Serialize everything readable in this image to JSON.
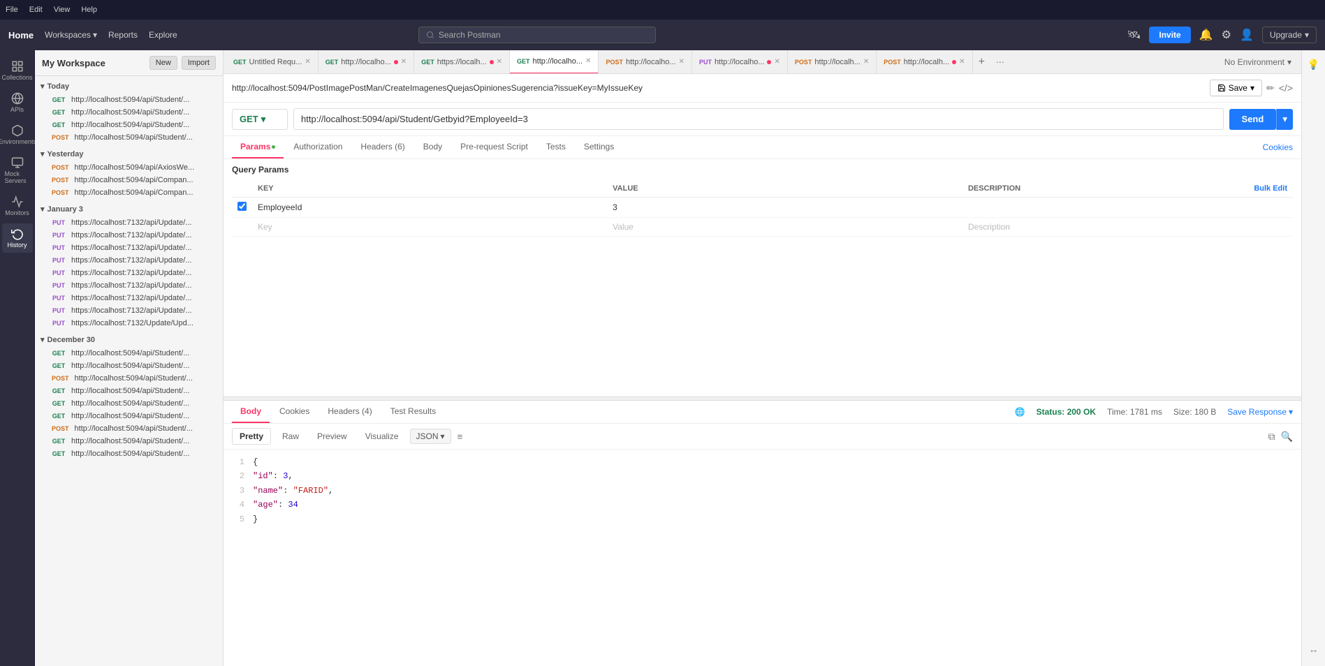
{
  "menubar": {
    "items": [
      "File",
      "Edit",
      "View",
      "Help"
    ]
  },
  "header": {
    "nav": [
      {
        "label": "Home"
      },
      {
        "label": "Workspaces",
        "hasArrow": true
      },
      {
        "label": "Reports"
      },
      {
        "label": "Explore"
      }
    ],
    "search": {
      "placeholder": "Search Postman"
    },
    "invite_label": "Invite",
    "upgrade_label": "Upgrade"
  },
  "sidebar": {
    "workspace_title": "My Workspace",
    "new_label": "New",
    "import_label": "Import",
    "icons": [
      {
        "name": "Collections",
        "icon": "collections-icon"
      },
      {
        "name": "APIs",
        "icon": "apis-icon"
      },
      {
        "name": "Environments",
        "icon": "environments-icon"
      },
      {
        "name": "Mock Servers",
        "icon": "mock-icon"
      },
      {
        "name": "Monitors",
        "icon": "monitors-icon"
      },
      {
        "name": "History",
        "icon": "history-icon"
      }
    ],
    "history_groups": [
      {
        "label": "Today",
        "items": [
          {
            "method": "GET",
            "url": "http://localhost:5094/api/Student/..."
          },
          {
            "method": "GET",
            "url": "http://localhost:5094/api/Student/..."
          },
          {
            "method": "GET",
            "url": "http://localhost:5094/api/Student/..."
          },
          {
            "method": "POST",
            "url": "http://localhost:5094/api/Student/..."
          }
        ]
      },
      {
        "label": "Yesterday",
        "items": [
          {
            "method": "POST",
            "url": "http://localhost:5094/api/AxiosWe..."
          },
          {
            "method": "POST",
            "url": "http://localhost:5094/api/Compan..."
          },
          {
            "method": "POST",
            "url": "http://localhost:5094/api/Compan..."
          }
        ]
      },
      {
        "label": "January 3",
        "items": [
          {
            "method": "PUT",
            "url": "https://localhost:7132/api/Update/..."
          },
          {
            "method": "PUT",
            "url": "https://localhost:7132/api/Update/..."
          },
          {
            "method": "PUT",
            "url": "https://localhost:7132/api/Update/..."
          },
          {
            "method": "PUT",
            "url": "https://localhost:7132/api/Update/..."
          },
          {
            "method": "PUT",
            "url": "https://localhost:7132/api/Update/..."
          },
          {
            "method": "PUT",
            "url": "https://localhost:7132/api/Update/..."
          },
          {
            "method": "PUT",
            "url": "https://localhost:7132/api/Update/..."
          },
          {
            "method": "PUT",
            "url": "https://localhost:7132/api/Update/..."
          },
          {
            "method": "PUT",
            "url": "https://localhost:7132/Update/Upd..."
          }
        ]
      },
      {
        "label": "December 30",
        "items": [
          {
            "method": "GET",
            "url": "http://localhost:5094/api/Student/..."
          },
          {
            "method": "GET",
            "url": "http://localhost:5094/api/Student/..."
          },
          {
            "method": "POST",
            "url": "http://localhost:5094/api/Student/..."
          },
          {
            "method": "GET",
            "url": "http://localhost:5094/api/Student/..."
          },
          {
            "method": "GET",
            "url": "http://localhost:5094/api/Student/..."
          },
          {
            "method": "GET",
            "url": "http://localhost:5094/api/Student/..."
          },
          {
            "method": "POST",
            "url": "http://localhost:5094/api/Student/..."
          },
          {
            "method": "GET",
            "url": "http://localhost:5094/api/Student/..."
          },
          {
            "method": "GET",
            "url": "http://localhost:5094/api/Student/..."
          }
        ]
      }
    ]
  },
  "tabs": [
    {
      "method": "GET",
      "url": "Untitled Requ...",
      "active": false,
      "dot": false
    },
    {
      "method": "GET",
      "url": "http://localho...",
      "active": false,
      "dot": true
    },
    {
      "method": "GET",
      "url": "https://localh...",
      "active": false,
      "dot": true
    },
    {
      "method": "GET",
      "url": "http://localho...",
      "active": true,
      "dot": false
    },
    {
      "method": "POST",
      "url": "http://localho...",
      "active": false,
      "dot": false
    },
    {
      "method": "PUT",
      "url": "http://localho...",
      "active": false,
      "dot": true
    },
    {
      "method": "POST",
      "url": "http://localh...",
      "active": false,
      "dot": false
    },
    {
      "method": "POST",
      "url": "http://localh...",
      "active": false,
      "dot": true
    }
  ],
  "request": {
    "url_display": "http://localhost:5094/PostImagePostMan/CreateImagenesQuejasOpinionesSugerencia?issueKey=MyIssueKey",
    "method": "GET",
    "url": "http://localhost:5094/api/Student/Getbyid?EmployeeId=3",
    "send_label": "Send",
    "save_label": "Save",
    "tabs": [
      {
        "label": "Params",
        "active": true,
        "dot": true
      },
      {
        "label": "Authorization"
      },
      {
        "label": "Headers (6)"
      },
      {
        "label": "Body"
      },
      {
        "label": "Pre-request Script"
      },
      {
        "label": "Tests"
      },
      {
        "label": "Settings"
      }
    ],
    "cookies_label": "Cookies",
    "params": {
      "title": "Query Params",
      "columns": [
        "KEY",
        "VALUE",
        "DESCRIPTION"
      ],
      "bulk_edit_label": "Bulk Edit",
      "rows": [
        {
          "checked": true,
          "key": "EmployeeId",
          "value": "3",
          "description": ""
        },
        {
          "checked": false,
          "key": "Key",
          "value": "Value",
          "description": "Description",
          "placeholder": true
        }
      ]
    }
  },
  "response": {
    "tabs": [
      {
        "label": "Body",
        "active": true
      },
      {
        "label": "Cookies"
      },
      {
        "label": "Headers (4)"
      },
      {
        "label": "Test Results"
      }
    ],
    "status": "Status: 200 OK",
    "time": "Time: 1781 ms",
    "size": "Size: 180 B",
    "save_response_label": "Save Response",
    "formats": [
      {
        "label": "Pretty",
        "active": true
      },
      {
        "label": "Raw"
      },
      {
        "label": "Preview"
      },
      {
        "label": "Visualize"
      }
    ],
    "format_select": "JSON",
    "body_lines": [
      {
        "num": "1",
        "content": "{"
      },
      {
        "num": "2",
        "content": "    \"id\": 3,"
      },
      {
        "num": "3",
        "content": "    \"name\": \"FARID\","
      },
      {
        "num": "4",
        "content": "    \"age\": 34"
      },
      {
        "num": "5",
        "content": "}"
      }
    ]
  }
}
